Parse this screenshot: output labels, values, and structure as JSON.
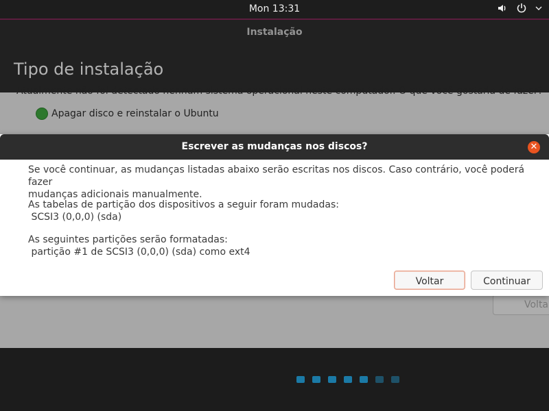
{
  "topbar": {
    "clock": "Mon 13:31",
    "volume_icon": "speaker-icon",
    "power_icon": "power-icon"
  },
  "window": {
    "title": "Instalação",
    "page_title": "Tipo de instalação",
    "question": "Atualmente não foi detectado nenhum sistema operacional neste computador. O que você gostaria de fazer?",
    "option_label": "Apagar disco e reinstalar o Ubuntu",
    "back_button_label": "Volta"
  },
  "dialog": {
    "title": "Escrever as mudanças nos discos?",
    "paragraph1_line1": "Se você continuar, as mudanças listadas abaixo serão escritas nos discos. Caso contrário, você poderá fazer",
    "paragraph1_line2": "mudanças adicionais manualmente.",
    "paragraph2_line1": "As tabelas de partição dos dispositivos a seguir foram mudadas:",
    "paragraph2_line2": " SCSI3 (0,0,0) (sda)",
    "paragraph3_line1": "As seguintes partições serão formatadas:",
    "paragraph3_line2": " partição #1 de SCSI3 (0,0,0) (sda) como ext4",
    "back_label": "Voltar",
    "continue_label": "Continuar"
  },
  "progress": {
    "active_steps": 5,
    "total_steps": 7
  },
  "colors": {
    "accent": "#e95420",
    "dot_active": "#1b7aa6",
    "dot_inactive": "#1e5168"
  }
}
